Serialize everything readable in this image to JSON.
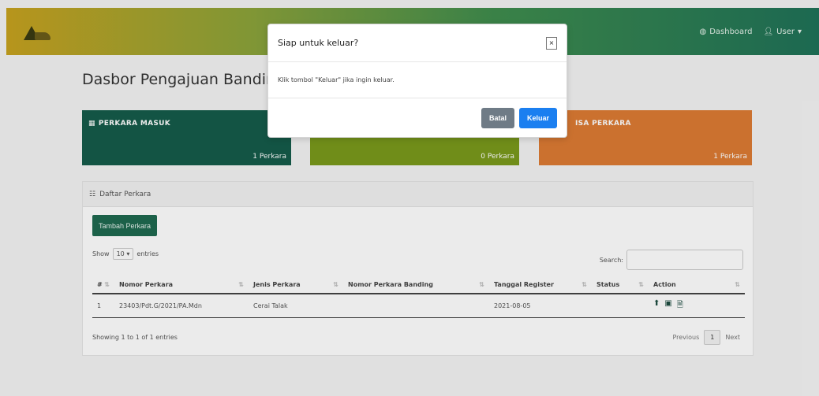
{
  "navbar": {
    "logo_text": "",
    "dashboard": "Dashboard",
    "user": "User",
    "icons": {
      "dashboard": "dashboard-icon",
      "user": "user-icon",
      "caret": "caret-down-icon"
    }
  },
  "page": {
    "title": "Dasbor Pengajuan Banding"
  },
  "cards": [
    {
      "title": "PERKARA MASUK",
      "count": "1 Perkara",
      "color": "#155c4a"
    },
    {
      "title": "",
      "count": "0 Perkara",
      "color": "#7a9a1c"
    },
    {
      "title": "ISA PERKARA",
      "count": "1 Perkara",
      "color": "#dd7b33"
    }
  ],
  "panel": {
    "title": "Daftar Perkara",
    "add_button": "Tambah Perkara",
    "show_label": "Show",
    "show_value": "10",
    "entries_label": "entries",
    "search_label": "Search:",
    "search_value": "",
    "columns": [
      "#",
      "Nomor Perkara",
      "Jenis Perkara",
      "Nomor Perkara Banding",
      "Tanggal Register",
      "Status",
      "Action"
    ],
    "rows": [
      {
        "no": "1",
        "nomor": "23403/Pdt.G/2021/PA.Mdn",
        "jenis": "Cerai Talak",
        "banding": "",
        "tanggal": "2021-08-05",
        "status": ""
      }
    ],
    "footer": "Showing 1 to 1 of 1 entries",
    "pager": {
      "prev": "Previous",
      "current": "1",
      "next": "Next"
    }
  },
  "modal": {
    "title": "Siap untuk keluar?",
    "close": "×",
    "body": "Klik tombol \"Keluar\" jika ingin keluar.",
    "cancel": "Batal",
    "confirm": "Keluar"
  },
  "colors": {
    "navbar_start": "#c7a21f",
    "navbar_end": "#1f7258",
    "accent_blue": "#1b7ff0",
    "button_grey": "#6f7b86"
  }
}
